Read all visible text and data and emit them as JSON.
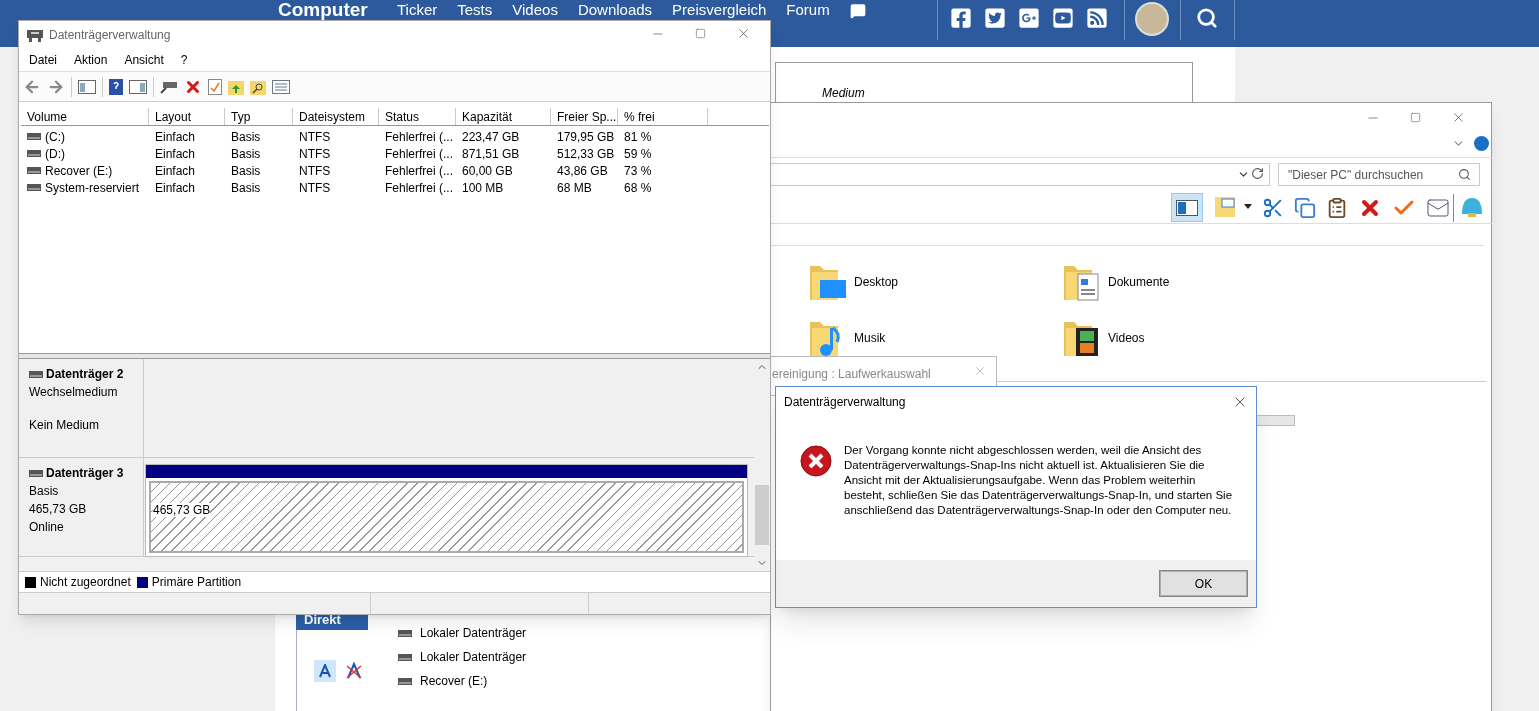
{
  "website": {
    "logo": "Computer",
    "nav": [
      "Ticker",
      "Tests",
      "Videos",
      "Downloads",
      "Preisvergleich",
      "Forum"
    ],
    "behind_text": "Medium"
  },
  "disk_management": {
    "title": "Datenträgerverwaltung",
    "menu": [
      "Datei",
      "Aktion",
      "Ansicht",
      "?"
    ],
    "columns": [
      "Volume",
      "Layout",
      "Typ",
      "Dateisystem",
      "Status",
      "Kapazität",
      "Freier Sp...",
      "% frei"
    ],
    "rows": [
      [
        "(C:)",
        "Einfach",
        "Basis",
        "NTFS",
        "Fehlerfrei (...",
        "223,47 GB",
        "179,95 GB",
        "81 %"
      ],
      [
        "(D:)",
        "Einfach",
        "Basis",
        "NTFS",
        "Fehlerfrei (...",
        "871,51 GB",
        "512,33 GB",
        "59 %"
      ],
      [
        "Recover (E:)",
        "Einfach",
        "Basis",
        "NTFS",
        "Fehlerfrei (...",
        "60,00 GB",
        "43,86 GB",
        "73 %"
      ],
      [
        "System-reserviert",
        "Einfach",
        "Basis",
        "NTFS",
        "Fehlerfrei (...",
        "100 MB",
        "68 MB",
        "68 %"
      ]
    ],
    "disks": [
      {
        "kind": "removable",
        "name": "Datenträger 2",
        "type": "Wechselmedium",
        "status": "Kein Medium"
      },
      {
        "kind": "basic",
        "name": "Datenträger 3",
        "type": "Basis",
        "size": "465,73 GB",
        "status": "Online",
        "partition_size": "465,73 GB"
      }
    ],
    "legend": [
      {
        "label": "Nicht zugeordnet",
        "color": "#000000"
      },
      {
        "label": "Primäre Partition",
        "color": "#000080"
      }
    ]
  },
  "explorer": {
    "search": {
      "placeholder": "\"Dieser PC\" durchsuchen"
    },
    "pane_toggle_on": true,
    "usage_bar": {
      "level": 0
    },
    "folders": [
      {
        "kind": "desktop",
        "label": "Desktop"
      },
      {
        "kind": "documents",
        "label": "Dokumente"
      },
      {
        "kind": "music",
        "label": "Musik"
      },
      {
        "kind": "videos",
        "label": "Videos"
      }
    ]
  },
  "cleanup_dialog": {
    "title": "ereinigung : Laufwerkauswahl"
  },
  "error_dialog": {
    "title": "Datenträgerverwaltung",
    "message": "Der Vorgang konnte nicht abgeschlossen werden, weil die Ansicht des Datenträgerverwaltungs-Snap-Ins nicht aktuell ist. Aktualisieren Sie die Ansicht mit der Aktualisierungsaufgabe. Wenn das Problem weiterhin besteht, schließen Sie das Datenträgerverwaltungs-Snap-In, und starten Sie anschließend das Datenträgerverwaltungs-Snap-In oder den Computer neu.",
    "buttons": [
      "OK"
    ]
  },
  "background_window": {
    "header": "Direkt",
    "items": [
      "Lokaler Datenträger",
      "Lokaler Datenträger",
      "Recover (E:)"
    ]
  }
}
